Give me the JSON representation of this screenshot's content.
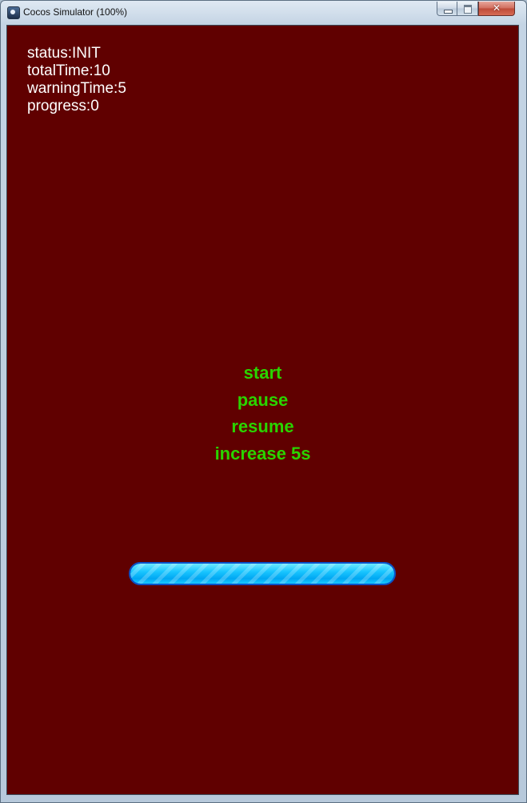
{
  "window": {
    "title": "Cocos Simulator (100%)",
    "icons": {
      "app": "cocos-app-icon",
      "minimize": "minimize-icon",
      "maximize": "maximize-icon",
      "close": "close-icon"
    },
    "close_glyph": "✕"
  },
  "game": {
    "background_color": "#600000",
    "status_lines": [
      "status:INIT",
      "totalTime:10",
      "warningTime:5",
      "progress:0"
    ],
    "menu_color": "#2ad400",
    "menu": [
      "start",
      "pause",
      "resume",
      "increase 5s"
    ],
    "progress_bar": {
      "fill_fraction": 1.0,
      "fill_color": "#19c5ff"
    }
  }
}
